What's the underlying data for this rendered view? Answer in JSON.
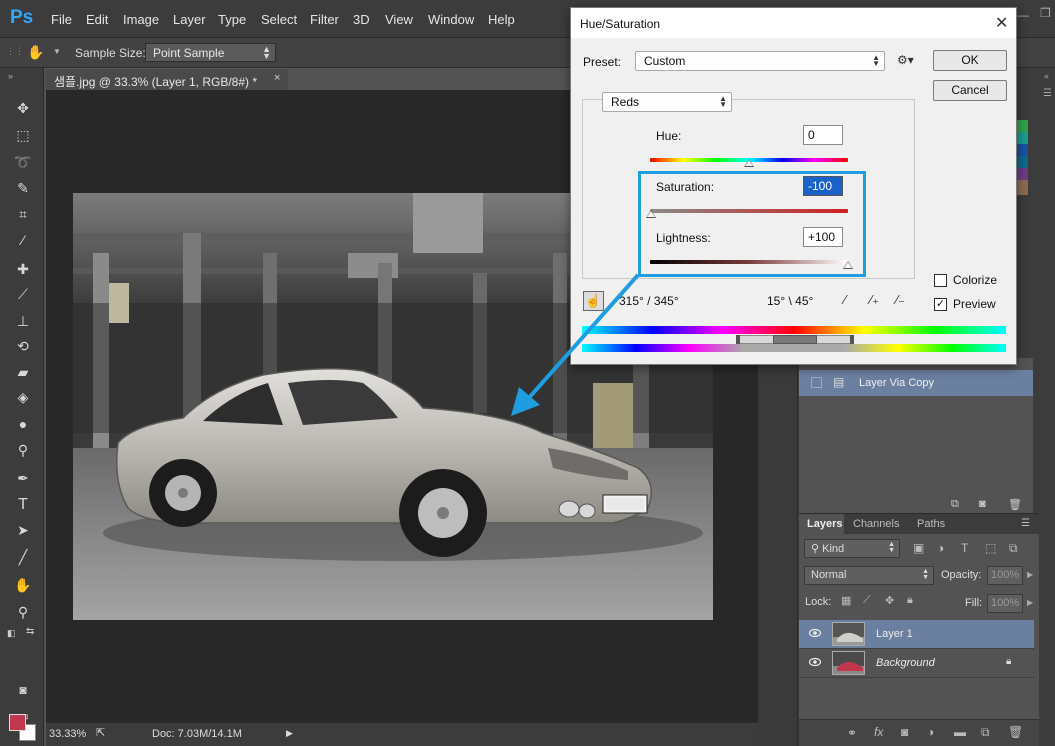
{
  "app": {
    "logo": "Ps",
    "menu": [
      "File",
      "Edit",
      "Image",
      "Layer",
      "Type",
      "Select",
      "Filter",
      "3D",
      "View",
      "Window",
      "Help"
    ]
  },
  "options_bar": {
    "sample_size_label": "Sample Size:",
    "sample_size_value": "Point Sample"
  },
  "document": {
    "tab_title": "샘플.jpg @ 33.3% (Layer 1, RGB/8#) *",
    "tab_close": "×",
    "zoom": "33.33%",
    "doc_info": "Doc: 7.03M/14.1M"
  },
  "dialog": {
    "title": "Hue/Saturation",
    "close": "✕",
    "preset_label": "Preset:",
    "preset_value": "Custom",
    "ok": "OK",
    "cancel": "Cancel",
    "channel": "Reds",
    "hue_label": "Hue:",
    "hue_value": "0",
    "saturation_label": "Saturation:",
    "saturation_value": "-100",
    "lightness_label": "Lightness:",
    "lightness_value": "+100",
    "colorize_label": "Colorize",
    "colorize_checked": false,
    "preview_label": "Preview",
    "preview_checked": true,
    "range_left": "315° / 345°",
    "range_right": "15° \\ 45°"
  },
  "layers_panel": {
    "tabs": [
      "Layers",
      "Channels",
      "Paths"
    ],
    "kind": "Kind",
    "blend_mode": "Normal",
    "opacity_label": "Opacity:",
    "opacity_value": "100%",
    "lock_label": "Lock:",
    "fill_label": "Fill:",
    "fill_value": "100%",
    "layers": [
      {
        "name": "Layer 1",
        "selected": true,
        "locked": false
      },
      {
        "name": "Background",
        "selected": false,
        "locked": true
      }
    ]
  },
  "history_panel": {
    "item": "Layer Via Copy"
  },
  "colors": {
    "ps_blue": "#31a8ff",
    "foreground": "#c0374e",
    "background": "#ffffff",
    "annotation_blue": "#1e9de0",
    "layer_selected": "#6b7fa0"
  }
}
